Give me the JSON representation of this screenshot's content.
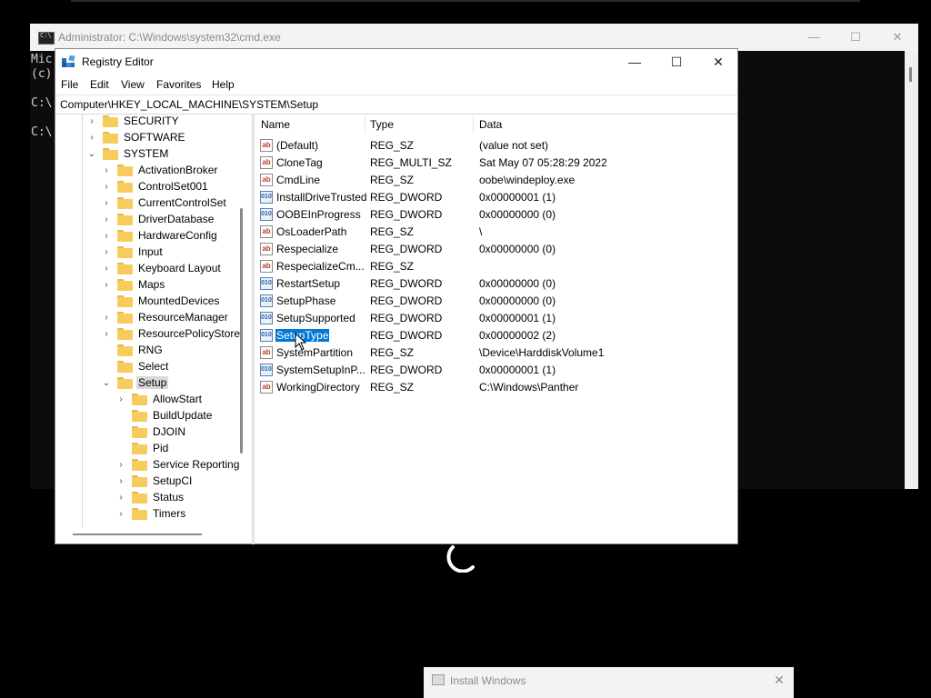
{
  "cmd": {
    "title": "Administrator: C:\\Windows\\system32\\cmd.exe",
    "lines": [
      "Mic",
      "(c)",
      "",
      "C:\\",
      "",
      "C:\\"
    ],
    "minimize": "—",
    "maximize": "☐",
    "close": "✕"
  },
  "regedit": {
    "title": "Registry Editor",
    "minimize": "—",
    "maximize": "☐",
    "close": "✕",
    "menu": [
      "File",
      "Edit",
      "View",
      "Favorites",
      "Help"
    ],
    "address": "Computer\\HKEY_LOCAL_MACHINE\\SYSTEM\\Setup",
    "tree": [
      {
        "label": "SECURITY",
        "chevron": "›"
      },
      {
        "label": "SOFTWARE",
        "chevron": "›"
      },
      {
        "label": "SYSTEM",
        "chevron": "⌄"
      },
      {
        "label": "ActivationBroker",
        "chevron": "›"
      },
      {
        "label": "ControlSet001",
        "chevron": "›"
      },
      {
        "label": "CurrentControlSet",
        "chevron": "›"
      },
      {
        "label": "DriverDatabase",
        "chevron": "›"
      },
      {
        "label": "HardwareConfig",
        "chevron": "›"
      },
      {
        "label": "Input",
        "chevron": "›"
      },
      {
        "label": "Keyboard Layout",
        "chevron": "›"
      },
      {
        "label": "Maps",
        "chevron": "›"
      },
      {
        "label": "MountedDevices",
        "chevron": ""
      },
      {
        "label": "ResourceManager",
        "chevron": "›"
      },
      {
        "label": "ResourcePolicyStore",
        "chevron": "›"
      },
      {
        "label": "RNG",
        "chevron": ""
      },
      {
        "label": "Select",
        "chevron": ""
      },
      {
        "label": "Setup",
        "chevron": "⌄"
      },
      {
        "label": "AllowStart",
        "chevron": "›"
      },
      {
        "label": "BuildUpdate",
        "chevron": ""
      },
      {
        "label": "DJOIN",
        "chevron": ""
      },
      {
        "label": "Pid",
        "chevron": ""
      },
      {
        "label": "Service Reporting",
        "chevron": "›"
      },
      {
        "label": "SetupCI",
        "chevron": "›"
      },
      {
        "label": "Status",
        "chevron": "›"
      },
      {
        "label": "Timers",
        "chevron": "›"
      }
    ],
    "columns": {
      "name": "Name",
      "type": "Type",
      "data": "Data"
    },
    "values": [
      {
        "icon": "ab",
        "name": "(Default)",
        "type": "REG_SZ",
        "data": "(value not set)"
      },
      {
        "icon": "ab",
        "name": "CloneTag",
        "type": "REG_MULTI_SZ",
        "data": "Sat May 07 05:28:29 2022"
      },
      {
        "icon": "ab",
        "name": "CmdLine",
        "type": "REG_SZ",
        "data": "oobe\\windeploy.exe"
      },
      {
        "icon": "010",
        "name": "InstallDriveTrusted",
        "type": "REG_DWORD",
        "data": "0x00000001 (1)"
      },
      {
        "icon": "010",
        "name": "OOBEInProgress",
        "type": "REG_DWORD",
        "data": "0x00000000 (0)"
      },
      {
        "icon": "ab",
        "name": "OsLoaderPath",
        "type": "REG_SZ",
        "data": "\\"
      },
      {
        "icon": "ab",
        "name": "Respecialize",
        "type": "REG_DWORD",
        "data": "0x00000000 (0)"
      },
      {
        "icon": "ab",
        "name": "RespecializeCm...",
        "type": "REG_SZ",
        "data": ""
      },
      {
        "icon": "010",
        "name": "RestartSetup",
        "type": "REG_DWORD",
        "data": "0x00000000 (0)"
      },
      {
        "icon": "010",
        "name": "SetupPhase",
        "type": "REG_DWORD",
        "data": "0x00000000 (0)"
      },
      {
        "icon": "010",
        "name": "SetupSupported",
        "type": "REG_DWORD",
        "data": "0x00000001 (1)"
      },
      {
        "icon": "010",
        "name": "SetupType",
        "type": "REG_DWORD",
        "data": "0x00000002 (2)"
      },
      {
        "icon": "ab",
        "name": "SystemPartition",
        "type": "REG_SZ",
        "data": "\\Device\\HarddiskVolume1"
      },
      {
        "icon": "010",
        "name": "SystemSetupInP...",
        "type": "REG_DWORD",
        "data": "0x00000001 (1)"
      },
      {
        "icon": "ab",
        "name": "WorkingDirectory",
        "type": "REG_SZ",
        "data": "C:\\Windows\\Panther"
      }
    ]
  },
  "install": {
    "title": "Install Windows",
    "close": "✕"
  },
  "colors": {
    "selection": "#0078d7",
    "folder": "#f6cd5c",
    "desktop": "#000000"
  }
}
